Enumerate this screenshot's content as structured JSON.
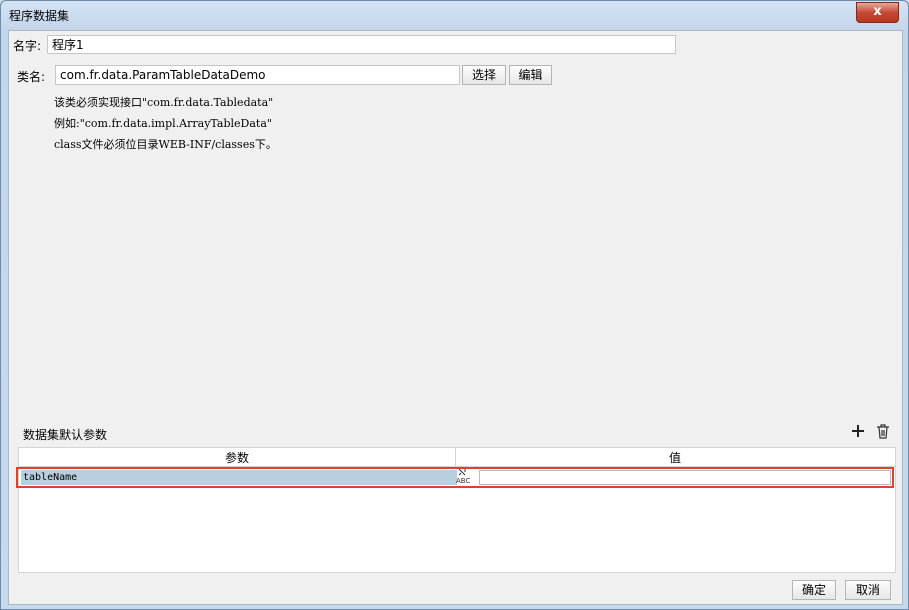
{
  "window": {
    "title": "程序数据集",
    "close_label": "x"
  },
  "form": {
    "name_label": "名字:",
    "name_value": "程序1",
    "class_label": "类名:",
    "class_value": "com.fr.data.ParamTableDataDemo",
    "select_button": "选择",
    "edit_button": "编辑"
  },
  "info": {
    "line1": "该类必须实现接口\"com.fr.data.Tabledata\"",
    "line2": "例如:\"com.fr.data.impl.ArrayTableData\"",
    "line3": "class文件必须位目录WEB-INF/classes下。"
  },
  "params": {
    "section_title": "数据集默认参数",
    "columns": [
      "参数",
      "值"
    ],
    "rows": [
      {
        "param": "tableName",
        "value": ""
      }
    ],
    "add_icon": "plus-icon",
    "delete_icon": "trash-icon",
    "type_icon_text": "ABC"
  },
  "footer": {
    "ok_button": "确定",
    "cancel_button": "取消"
  },
  "colors": {
    "highlight_border": "#e0412f",
    "selected_row": "#b8cfe0"
  }
}
